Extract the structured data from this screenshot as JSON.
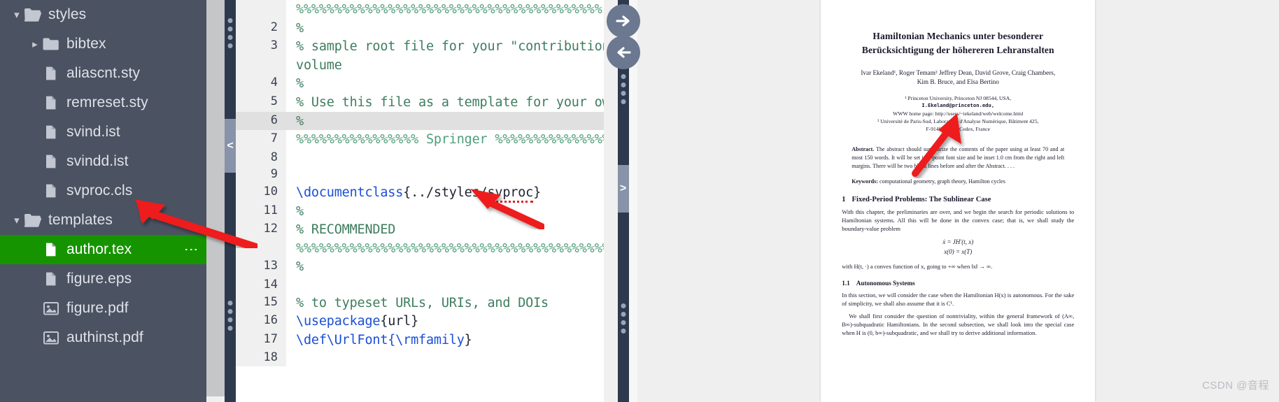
{
  "sidebar": {
    "items": [
      {
        "label": "styles",
        "icon": "folder-open-icon",
        "twisty": "chevron-down",
        "indent": 0,
        "selected": false
      },
      {
        "label": "bibtex",
        "icon": "folder-icon",
        "twisty": "chevron-right",
        "indent": 1,
        "selected": false
      },
      {
        "label": "aliascnt.sty",
        "icon": "file-icon",
        "twisty": "",
        "indent": 1,
        "selected": false
      },
      {
        "label": "remreset.sty",
        "icon": "file-icon",
        "twisty": "",
        "indent": 1,
        "selected": false
      },
      {
        "label": "svind.ist",
        "icon": "file-icon",
        "twisty": "",
        "indent": 1,
        "selected": false
      },
      {
        "label": "svindd.ist",
        "icon": "file-icon",
        "twisty": "",
        "indent": 1,
        "selected": false
      },
      {
        "label": "svproc.cls",
        "icon": "file-icon",
        "twisty": "",
        "indent": 1,
        "selected": false
      },
      {
        "label": "templates",
        "icon": "folder-open-icon",
        "twisty": "chevron-down",
        "indent": 0,
        "selected": false
      },
      {
        "label": "author.tex",
        "icon": "file-icon",
        "twisty": "",
        "indent": 1,
        "selected": true
      },
      {
        "label": "figure.eps",
        "icon": "file-icon",
        "twisty": "",
        "indent": 1,
        "selected": false
      },
      {
        "label": "figure.pdf",
        "icon": "image-icon",
        "twisty": "",
        "indent": 1,
        "selected": false
      },
      {
        "label": "authinst.pdf",
        "icon": "image-icon",
        "twisty": "",
        "indent": 1,
        "selected": false
      }
    ],
    "selected_color": "#169400",
    "background_color": "#4b5262",
    "row_menu_label": "more-actions"
  },
  "editor": {
    "language": "latex",
    "active_line": 6,
    "lines": [
      {
        "num": "",
        "text": "%%%%%%%%%%%%%%%%%%%%%%%%%%%%%%%%%%%%%%%%",
        "kind": "pct",
        "wrap": true
      },
      {
        "num": "2",
        "text": "%",
        "kind": "cmt"
      },
      {
        "num": "3",
        "text": "% sample root file for your \"contribution\" to a proceedings",
        "kind": "cmt"
      },
      {
        "num": "",
        "text": "volume",
        "kind": "cmt",
        "wrap": true
      },
      {
        "num": "4",
        "text": "%",
        "kind": "cmt"
      },
      {
        "num": "5",
        "text": "% Use this file as a template for your own input.",
        "kind": "cmt"
      },
      {
        "num": "6",
        "text": "%",
        "kind": "cmt",
        "active": true
      },
      {
        "num": "7",
        "text": "%%%%%%%%%%%%%%%% Springer %%%%%%%%%%%%%%%%%%%%%%%%%%%%%%%%%%%%",
        "kind": "pct"
      },
      {
        "num": "8",
        "text": "",
        "kind": "cmt"
      },
      {
        "num": "9",
        "text": "",
        "kind": "cmt"
      },
      {
        "num": "10",
        "text": "\\documentclass{../styles/svproc}",
        "kind": "code"
      },
      {
        "num": "11",
        "text": "%",
        "kind": "cmt"
      },
      {
        "num": "12",
        "text": "% RECOMMENDED",
        "kind": "cmt"
      },
      {
        "num": "",
        "text": "%%%%%%%%%%%%%%%%%%%%%%%%%%%%%%%%%%%%%%%%%%%%%%%%%%%%%%%%%%%%%%%%%%%%%%",
        "kind": "pct",
        "wrap": true
      },
      {
        "num": "13",
        "text": "%",
        "kind": "cmt"
      },
      {
        "num": "14",
        "text": "",
        "kind": "cmt"
      },
      {
        "num": "15",
        "text": "% to typeset URLs, URIs, and DOIs",
        "kind": "cmt"
      },
      {
        "num": "16",
        "text": "\\usepackage{url}",
        "kind": "code"
      },
      {
        "num": "17",
        "text": "\\def\\UrlFont{\\rmfamily}",
        "kind": "code"
      },
      {
        "num": "18",
        "text": "",
        "kind": "cmt"
      }
    ],
    "documentclass": {
      "command": "\\documentclass",
      "open_brace": "{",
      "path_prefix": "../styles/",
      "misspelled": "svproc",
      "close_brace": "}"
    },
    "usepackage": {
      "command": "\\usepackage",
      "arg": "{url}"
    },
    "urlfont": {
      "part1": "\\def\\UrlFont{",
      "part2": "\\rmfamily",
      "part3": "}"
    }
  },
  "panel_controls": {
    "forward_button": "arrow-right",
    "back_button": "arrow-left",
    "left_collapse_chevron": "<",
    "right_expand_chevron": ">"
  },
  "pdf": {
    "title_line1": "Hamiltonian Mechanics unter besonderer",
    "title_line2": "Berücksichtigung der höhereren Lehranstalten",
    "authors_line1": "Ivar Ekeland¹, Roger Temam² Jeffrey Dean, David Grove, Craig Chambers,",
    "authors_line2": "Kim B. Bruce, and Elsa Bertino",
    "affil": [
      "¹  Princeton University, Princeton NJ 08544, USA,",
      "I.Ekeland@princeton.edu,",
      "WWW home page: http://users/~iekeland/web/welcome.html",
      "²  Université de Paris-Sud, Laboratoire d'Analyse Numérique, Bâtiment 425,",
      "F-91405 Orsay Cedex, France"
    ],
    "abstract_label": "Abstract.",
    "abstract_text": " The abstract should summarize the contents of the paper using at least 70 and at most 150 words. It will be set in 9-point font size and be inset 1.0 cm from the right and left margins. There will be two blank lines before and after the Abstract. . . .",
    "keywords_label": "Keywords:",
    "keywords_text": " computational geometry, graph theory, Hamilton cycles",
    "section_num": "1",
    "section_title": "Fixed-Period Problems: The Sublinear Case",
    "body1": "With this chapter, the preliminaries are over, and we begin the search for periodic solutions to Hamiltonian systems. All this will be done in the convex case; that is, we shall study the boundary-value problem",
    "eq1": "ẋ = JH′(t, x)",
    "eq2": "x(0) = x(T)",
    "body2": "with H(t, ·) a convex function of x, going to +∞ when ‖x‖ → ∞.",
    "subsection_num": "1.1",
    "subsection_title": "Autonomous Systems",
    "body3": "In this section, we will consider the case when the Hamiltonian H(x) is autonomous. For the sake of simplicity, we shall also assume that it is C¹.",
    "body4": "We shall first consider the question of nontriviality, within the general framework of (A∞, B∞)-subquadratic Hamiltonians. In the second subsection, we shall look into the special case when H is (0, b∞)-subquadratic, and we shall try to derive additional information."
  },
  "annotations": {
    "arrow1_target": "svproc.cls file in tree",
    "arrow2_target": "svproc in documentclass path",
    "arrow3_target": "pdf title block",
    "arrow_color": "#ee1c1c"
  },
  "watermark": {
    "text": "CSDN @音程"
  }
}
